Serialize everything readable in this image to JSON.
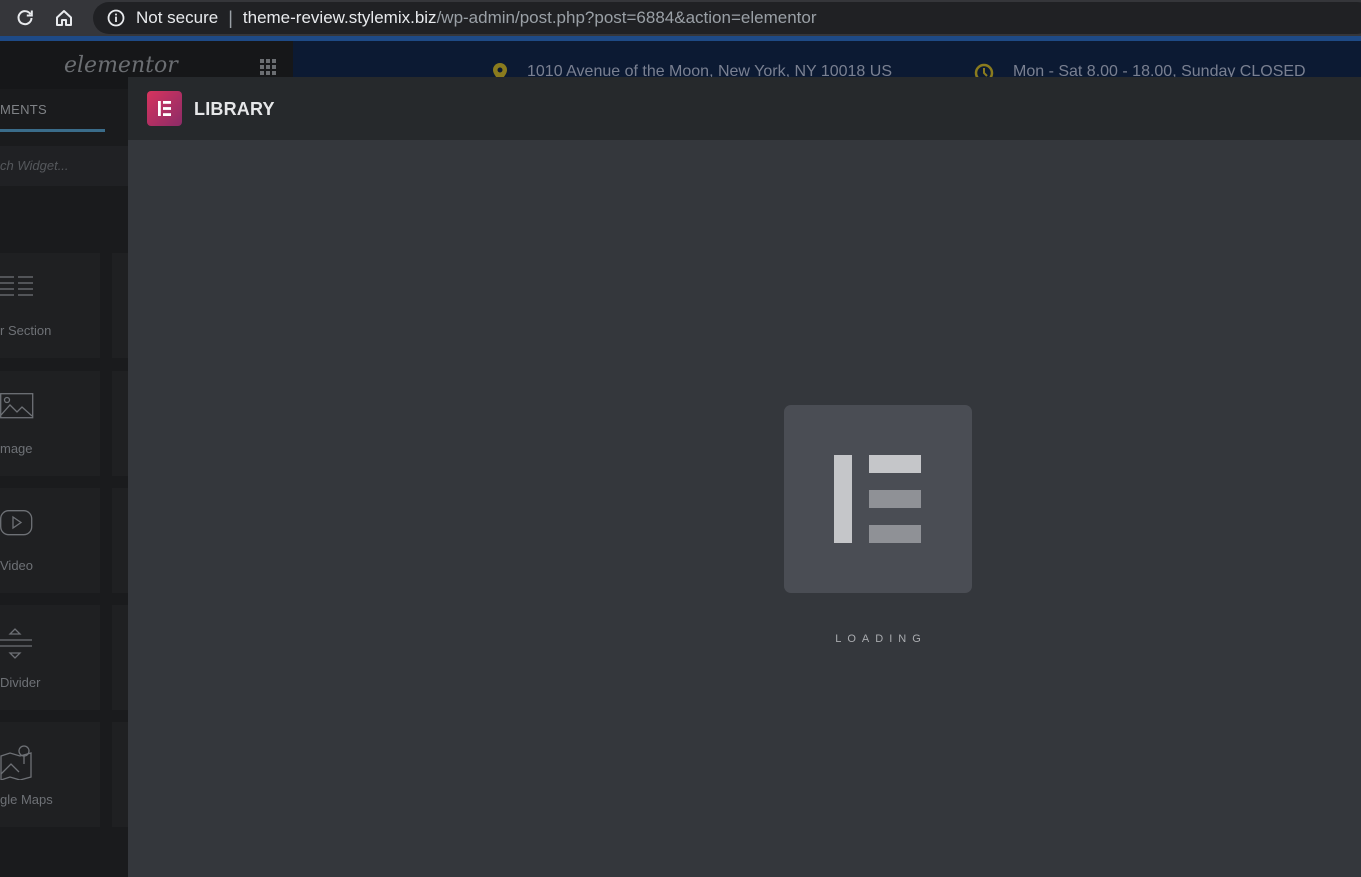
{
  "browser": {
    "not_secure": "Not secure",
    "separator": "|",
    "url_host": "theme-review.stylemix.biz",
    "url_path": "/wp-admin/post.php?post=6884&action=elementor"
  },
  "panel": {
    "logo": "elementor",
    "tab": "MENTS",
    "search_placeholder": "ch Widget...",
    "widgets": [
      {
        "label": "r Section",
        "icon": "inner-section-icon"
      },
      {
        "label": "mage",
        "icon": "image-icon"
      },
      {
        "label": "Video",
        "icon": "video-icon"
      },
      {
        "label": "Divider",
        "icon": "divider-icon"
      },
      {
        "label": "gle Maps",
        "icon": "google-maps-icon"
      }
    ]
  },
  "site": {
    "address": "1010 Avenue of the Moon, New York, NY 10018 US",
    "hours": "Mon - Sat 8.00 - 18.00, Sunday CLOSED"
  },
  "library": {
    "title": "LIBRARY",
    "loading": "LOADING"
  },
  "colors": {
    "accent_gradient_start": "#d7345e",
    "accent_gradient_end": "#8b2b67",
    "modal_bg": "#34373c"
  }
}
